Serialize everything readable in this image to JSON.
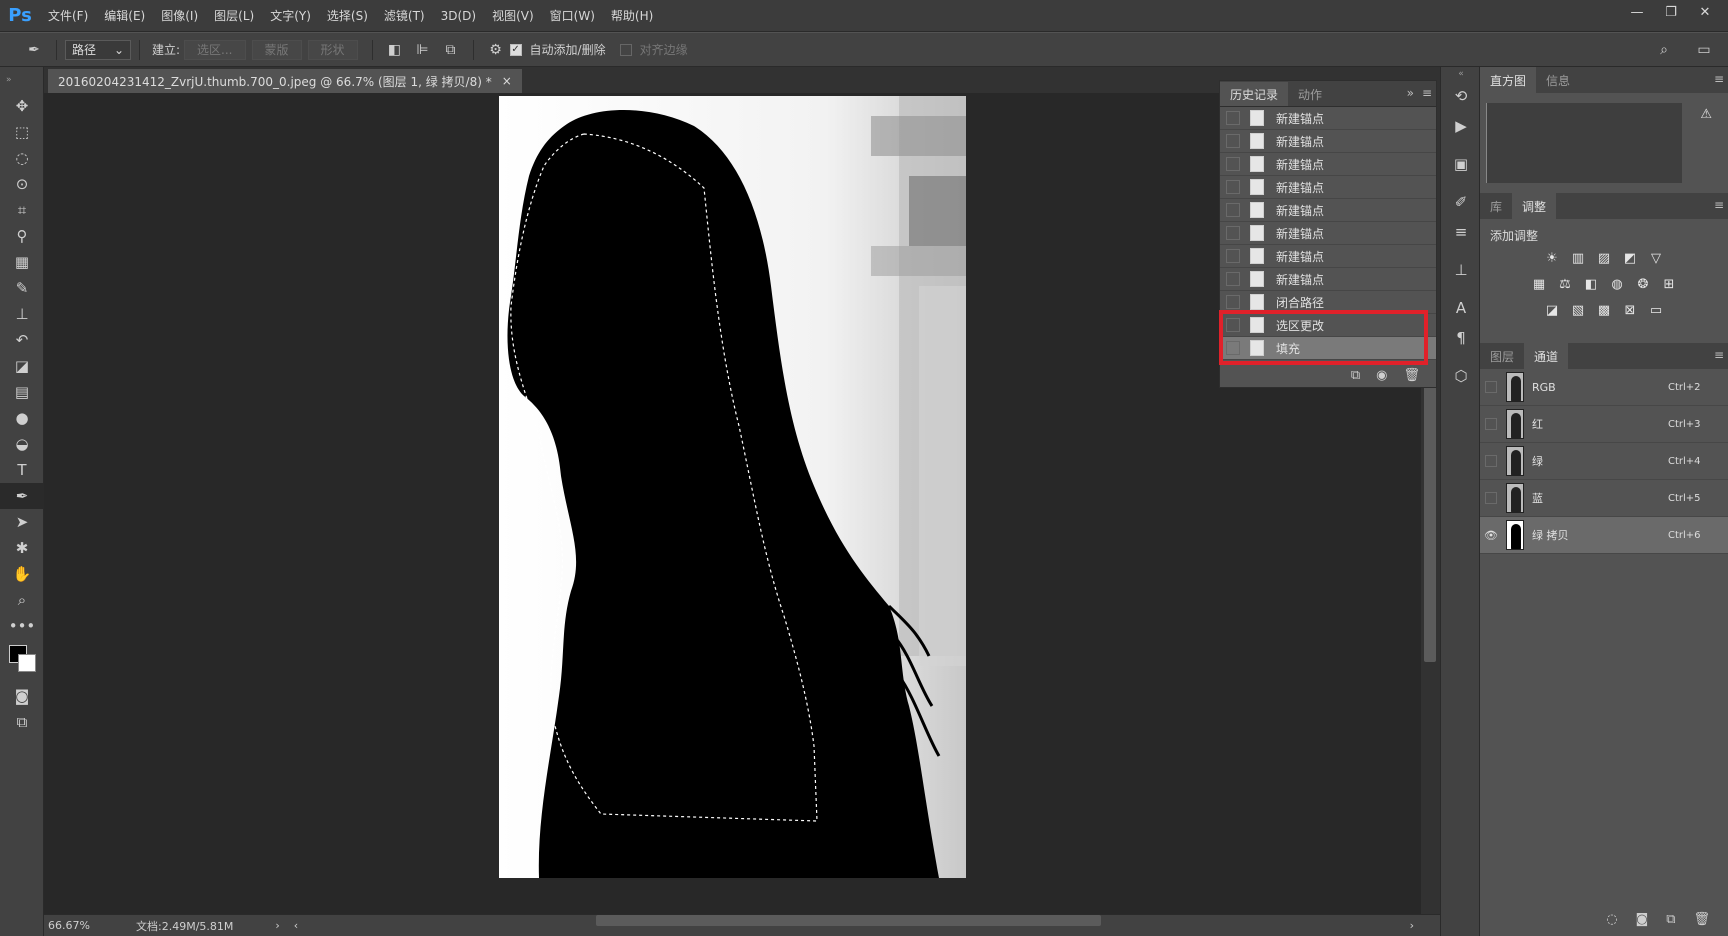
{
  "app": {
    "logo": "Ps"
  },
  "menu": [
    "文件(F)",
    "编辑(E)",
    "图像(I)",
    "图层(L)",
    "文字(Y)",
    "选择(S)",
    "滤镜(T)",
    "3D(D)",
    "视图(V)",
    "窗口(W)",
    "帮助(H)"
  ],
  "window_controls": {
    "minimize": "—",
    "restore": "❐",
    "close": "✕"
  },
  "options": {
    "mode_select": "路径",
    "build_label": "建立:",
    "selection_btn": "选区...",
    "mask_btn": "蒙版",
    "shape_btn": "形状",
    "auto_add_delete": "自动添加/删除",
    "align_edges": "对齐边缘"
  },
  "document": {
    "tab_title": "20160204231412_ZvrjU.thumb.700_0.jpeg @ 66.7% (图层 1, 绿 拷贝/8) *",
    "tab_close": "×",
    "zoom": "66.67%",
    "doc_info": "文档:2.49M/5.81M"
  },
  "history_panel": {
    "tabs": [
      "历史记录",
      "动作"
    ],
    "items": [
      {
        "label": "新建锚点",
        "selected": false
      },
      {
        "label": "新建锚点",
        "selected": false
      },
      {
        "label": "新建锚点",
        "selected": false
      },
      {
        "label": "新建锚点",
        "selected": false
      },
      {
        "label": "新建锚点",
        "selected": false
      },
      {
        "label": "新建锚点",
        "selected": false
      },
      {
        "label": "新建锚点",
        "selected": false
      },
      {
        "label": "新建锚点",
        "selected": false
      },
      {
        "label": "闭合路径",
        "selected": false
      },
      {
        "label": "选区更改",
        "selected": false
      },
      {
        "label": "填充",
        "selected": true
      }
    ]
  },
  "right_panels": {
    "top_tabs": [
      "直方图",
      "信息"
    ],
    "mid_tabs": [
      "库",
      "调整"
    ],
    "adjust_title": "添加调整",
    "bottom_tabs": [
      "图层",
      "通道"
    ],
    "channels": [
      {
        "name": "RGB",
        "shortcut": "Ctrl+2",
        "visible": false,
        "selected": false
      },
      {
        "name": "红",
        "shortcut": "Ctrl+3",
        "visible": false,
        "selected": false
      },
      {
        "name": "绿",
        "shortcut": "Ctrl+4",
        "visible": false,
        "selected": false
      },
      {
        "name": "蓝",
        "shortcut": "Ctrl+5",
        "visible": false,
        "selected": false
      },
      {
        "name": "绿 拷贝",
        "shortcut": "Ctrl+6",
        "visible": true,
        "selected": true
      }
    ]
  },
  "accent_colors": {
    "highlight_box": "#e0212a",
    "ps_blue": "#3aa0ff"
  }
}
